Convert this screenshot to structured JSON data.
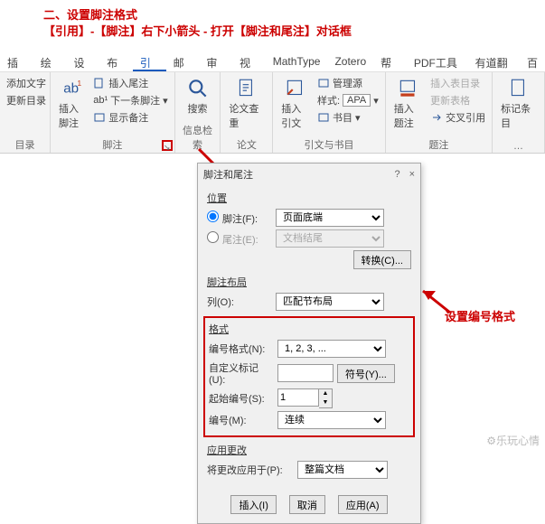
{
  "annotation": {
    "line1": "二、设置脚注格式",
    "line2": "【引用】-【脚注】右下小箭头 - 打开【脚注和尾注】对话框",
    "side": "设置编号格式"
  },
  "tabs": {
    "t0": "插入",
    "t1": "绘图",
    "t2": "设计",
    "t3": "布局",
    "t4": "引用",
    "t5": "邮件",
    "t6": "审阅",
    "t7": "视图",
    "t8": "MathType",
    "t9": "Zotero",
    "t10": "帮助",
    "t11": "PDF工具集",
    "t12": "有道翻译",
    "t13": "百"
  },
  "ribbon": {
    "g0": {
      "big": "目录",
      "s1": "添加文字",
      "s2": "更新目录",
      "lbl": "目录"
    },
    "g1": {
      "big": "插入脚注",
      "s1": "插入尾注",
      "s2": "下一条脚注",
      "s3": "显示备注",
      "lbl": "脚注"
    },
    "g2": {
      "big": "搜索",
      "lbl": "信息检索"
    },
    "g3": {
      "big": "论文查重",
      "lbl": "论文"
    },
    "g4": {
      "big": "插入引文",
      "s1": "管理源",
      "s2": "样式:",
      "s2v": "APA",
      "s3": "书目",
      "lbl": "引文与书目"
    },
    "g5": {
      "big": "插入题注",
      "s1": "插入表目录",
      "s2": "更新表格",
      "s3": "交叉引用",
      "lbl": "题注"
    },
    "g6": {
      "big": "标记条目",
      "lbl": "…"
    }
  },
  "dlg": {
    "title": "脚注和尾注",
    "help": "?",
    "close": "×",
    "s_pos": "位置",
    "r_foot": "脚注(F):",
    "v_foot": "页面底端",
    "r_end": "尾注(E):",
    "v_end": "文档结尾",
    "btn_conv": "转换(C)...",
    "s_layout": "脚注布局",
    "l_col": "列(O):",
    "v_col": "匹配节布局",
    "s_fmt": "格式",
    "l_numfmt": "编号格式(N):",
    "v_numfmt": "1, 2, 3, ...",
    "l_custom": "自定义标记(U):",
    "btn_sym": "符号(Y)...",
    "l_start": "起始编号(S):",
    "v_start": "1",
    "l_num": "编号(M):",
    "v_num": "连续",
    "s_apply": "应用更改",
    "l_apply": "将更改应用于(P):",
    "v_apply": "整篇文档",
    "btn_ins": "插入(I)",
    "btn_cancel": "取消",
    "btn_app": "应用(A)"
  },
  "wm": "⚙乐玩心情"
}
